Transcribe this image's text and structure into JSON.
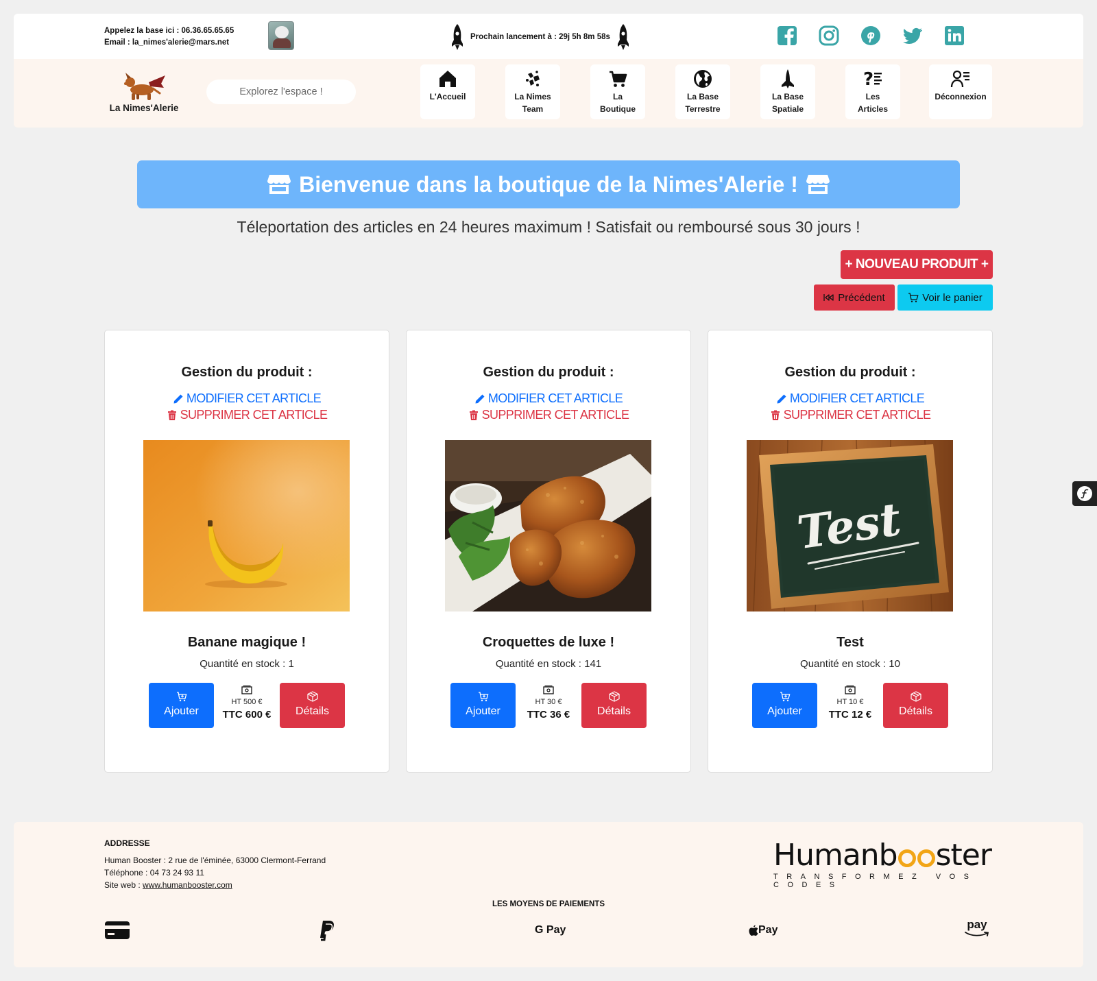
{
  "topbar": {
    "phone_line": "Appelez la base ici : 06.36.65.65.65",
    "email_line": "Email : la_nimes'alerie@mars.net",
    "launch_text": "Prochain lancement à : 29j 5h 8m 58s",
    "socials": [
      "facebook-icon",
      "instagram-icon",
      "pinterest-icon",
      "twitter-icon",
      "linkedin-icon"
    ],
    "social_color": "#3aa5a7"
  },
  "navbar": {
    "logo_text": "La Nimes'Alerie",
    "search_placeholder": "Explorez l'espace !",
    "items": [
      {
        "label": "L'Accueil",
        "icon": "home-icon"
      },
      {
        "label": "La Nimes\nTeam",
        "icon": "team-icon"
      },
      {
        "label": "La\nBoutique",
        "icon": "cart-icon"
      },
      {
        "label": "La Base\nTerrestre",
        "icon": "globe-icon"
      },
      {
        "label": "La Base\nSpatiale",
        "icon": "shuttle-icon"
      },
      {
        "label": "Les\nArticles",
        "icon": "articles-icon"
      },
      {
        "label": "Déconnexion",
        "icon": "user-logout-icon"
      }
    ]
  },
  "main": {
    "banner_title": "Bienvenue dans la boutique de la Nimes'Alerie !",
    "subtitle": "Téleportation des articles en 24 heures maximum ! Satisfait ou remboursé sous 30 jours !",
    "new_product_label": "+ NOUVEAU PRODUIT +",
    "prev_label": "Précédent",
    "cart_label": "Voir le panier",
    "colors": {
      "banner": "#6eb5fb",
      "danger": "#dc3545",
      "primary": "#0d6efd",
      "info": "#0dcaf0"
    }
  },
  "products": [
    {
      "management_title": "Gestion du produit :",
      "edit_label": "MODIFIER CET ARTICLE",
      "delete_label": "SUPPRIMER CET ARTICLE",
      "name": "Banane magique !",
      "stock": "Quantité en stock : 1",
      "add_label": "Ajouter",
      "ht": "HT 500 €",
      "ttc": "TTC 600 €",
      "details_label": "Détails"
    },
    {
      "management_title": "Gestion du produit :",
      "edit_label": "MODIFIER CET ARTICLE",
      "delete_label": "SUPPRIMER CET ARTICLE",
      "name": "Croquettes de luxe !",
      "stock": "Quantité en stock : 141",
      "add_label": "Ajouter",
      "ht": "HT 30 €",
      "ttc": "TTC 36 €",
      "details_label": "Détails"
    },
    {
      "management_title": "Gestion du produit :",
      "edit_label": "MODIFIER CET ARTICLE",
      "delete_label": "SUPPRIMER CET ARTICLE",
      "name": "Test",
      "stock": "Quantité en stock : 10",
      "add_label": "Ajouter",
      "ht": "HT 10 €",
      "ttc": "TTC 12 €",
      "details_label": "Détails",
      "image_text": "Test"
    }
  ],
  "footer": {
    "address_title": "ADDRESSE",
    "address_line": "Human Booster : 2 rue de l'éminée, 63000 Clermont-Ferrand",
    "phone_line": "Téléphone : 04 73 24 93 11",
    "site_prefix": "Site web : ",
    "site_link": "www.humanbooster.com",
    "brand_left": "Humanb",
    "brand_right": "ster",
    "brand_tagline": "TRANSFORMEZ VOS CODES",
    "payments_title": "LES MOYENS DE PAIEMENTS",
    "payments": [
      {
        "icon": "credit-card-icon",
        "label": ""
      },
      {
        "icon": "paypal-icon",
        "label": ""
      },
      {
        "icon": "google-pay-icon",
        "label": "G Pay"
      },
      {
        "icon": "apple-pay-icon",
        "label": " Pay"
      },
      {
        "icon": "amazon-pay-icon",
        "label": "pay"
      }
    ]
  }
}
